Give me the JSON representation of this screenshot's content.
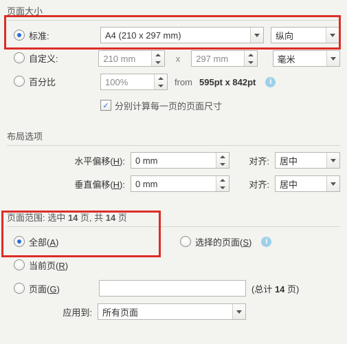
{
  "page_size": {
    "title": "页面大小",
    "standard": {
      "label": "标准:",
      "preset": "A4 (210 x 297 mm)",
      "orientation": "纵向"
    },
    "custom": {
      "label": "自定义:",
      "width": "210 mm",
      "height": "297 mm",
      "times": "x",
      "unit": "毫米"
    },
    "percent": {
      "label": "百分比",
      "value": "100%",
      "from_label": "from",
      "from_value": "595pt x 842pt"
    },
    "each_page_checkbox": "分别计算每一页的页面尺寸"
  },
  "layout": {
    "title": "布局选项",
    "h_offset": {
      "label_prefix": "水平偏移(",
      "accel": "H",
      "label_suffix": "):",
      "value": "0 mm",
      "align_label": "对齐:",
      "align_value": "居中"
    },
    "v_offset": {
      "label_prefix": "垂直偏移(",
      "accel": "H",
      "label_suffix": "):",
      "value": "0 mm",
      "align_label": "对齐:",
      "align_value": "居中"
    }
  },
  "range": {
    "title_prefix": "页面范围: 选中 ",
    "selected": "14",
    "mid": " 页, 共 ",
    "total": "14",
    "title_suffix": " 页",
    "all": {
      "prefix": "全部(",
      "accel": "A",
      "suffix": ")"
    },
    "selected_radio": {
      "prefix": "选择的页面(",
      "accel": "S",
      "suffix": ")"
    },
    "current": {
      "prefix": "当前页(",
      "accel": "R",
      "suffix": ")"
    },
    "pages": {
      "prefix": "页面(",
      "accel": "G",
      "suffix": ")",
      "value": "",
      "total_prefix": "(总计 ",
      "total_value": "14",
      "total_suffix": " 页)"
    },
    "apply_to": {
      "label": "应用到:",
      "value": "所有页面"
    }
  }
}
